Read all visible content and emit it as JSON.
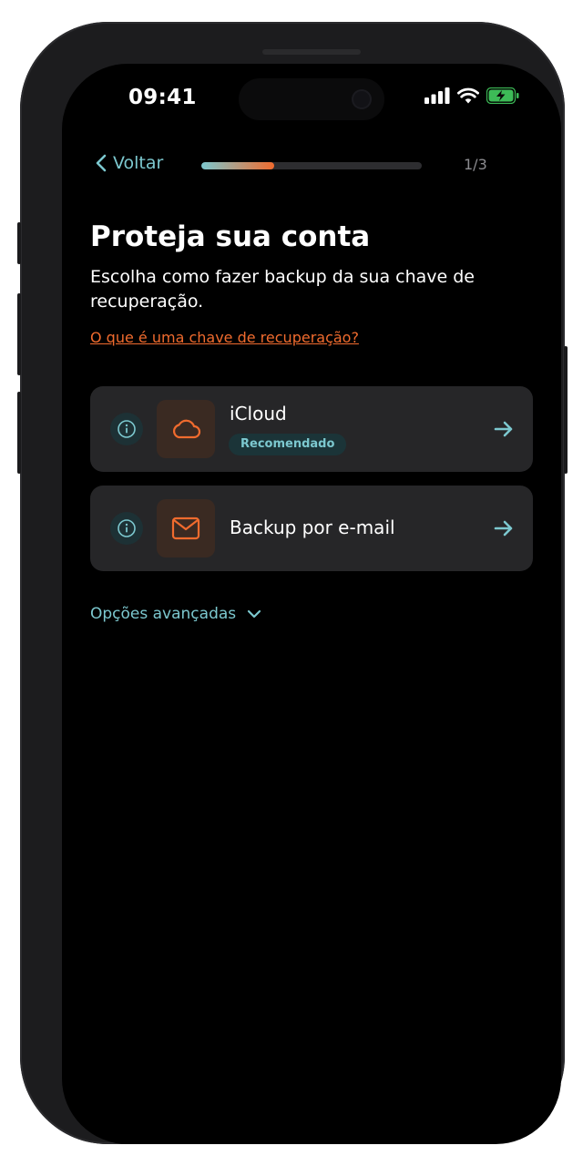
{
  "status_bar": {
    "time": "09:41",
    "signal_icon": "cellular-signal-icon",
    "wifi_icon": "wifi-icon",
    "battery_icon": "battery-charging-icon"
  },
  "header": {
    "back_label": "Voltar",
    "progress_fraction": 0.33,
    "step_indicator": "1/3"
  },
  "main": {
    "title": "Proteja sua conta",
    "subtitle": "Escolha como fazer backup da sua chave de recuperação.",
    "help_link": "O que é uma chave de recuperação?"
  },
  "options": [
    {
      "label": "iCloud",
      "badge": "Recomendado",
      "icon": "cloud-icon"
    },
    {
      "label": "Backup por e-mail",
      "icon": "mail-icon"
    }
  ],
  "advanced": {
    "label": "Opções avançadas"
  },
  "colors": {
    "accent_teal": "#7cc8cf",
    "accent_orange": "#f06b2e",
    "card_bg": "#262628",
    "screen_bg": "#000000"
  }
}
